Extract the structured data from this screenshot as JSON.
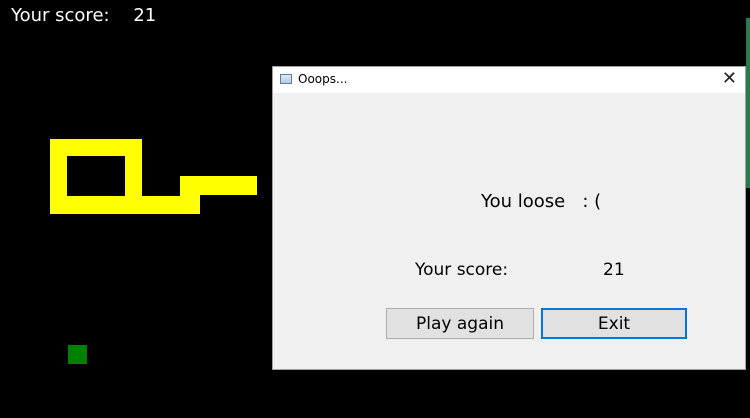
{
  "hud": {
    "score_label": "Your score:",
    "score_value": "21"
  },
  "game": {
    "snake_color": "#ffff00",
    "food_color": "#008000",
    "background": "#000000"
  },
  "dialog": {
    "title": "Ooops...",
    "close_glyph": "✕",
    "message": "You loose   : (",
    "score_label": "Your score:",
    "score_value": "21",
    "buttons": {
      "play_again": "Play again",
      "exit": "Exit"
    }
  }
}
